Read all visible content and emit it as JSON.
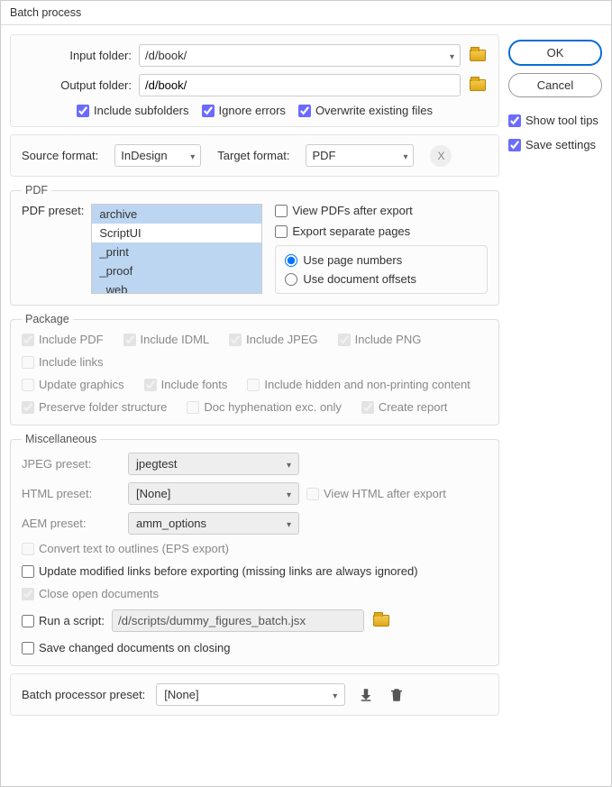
{
  "title": "Batch process",
  "buttons": {
    "ok": "OK",
    "cancel": "Cancel"
  },
  "sidebar": {
    "show_tool_tips": "Show tool tips",
    "save_settings": "Save settings"
  },
  "folders": {
    "input_label": "Input folder:",
    "input_value": "/d/book/",
    "output_label": "Output folder:",
    "output_value": "/d/book/",
    "include_subfolders": "Include subfolders",
    "ignore_errors": "Ignore errors",
    "overwrite": "Overwrite existing files"
  },
  "format": {
    "source_label": "Source format:",
    "source_value": "InDesign",
    "target_label": "Target format:",
    "target_value": "PDF"
  },
  "pdf": {
    "legend": "PDF",
    "preset_label": "PDF preset:",
    "items": [
      "archive",
      "ScriptUI",
      "_print",
      "_proof",
      "_web"
    ],
    "view_after": "View PDFs after export",
    "export_separate": "Export separate pages",
    "use_page_numbers": "Use page numbers",
    "use_doc_offsets": "Use document offsets"
  },
  "package": {
    "legend": "Package",
    "include_pdf": "Include PDF",
    "include_idml": "Include IDML",
    "include_jpeg": "Include JPEG",
    "include_png": "Include PNG",
    "include_links": "Include links",
    "update_graphics": "Update graphics",
    "include_fonts": "Include fonts",
    "include_hidden": "Include hidden and non-printing content",
    "preserve_structure": "Preserve folder structure",
    "doc_hyph": "Doc hyphenation exc. only",
    "create_report": "Create report"
  },
  "misc": {
    "legend": "Miscellaneous",
    "jpeg_label": "JPEG preset:",
    "jpeg_value": "jpegtest",
    "html_label": "HTML preset:",
    "html_value": "[None]",
    "view_html": "View HTML after export",
    "aem_label": "AEM preset:",
    "aem_value": "amm_options",
    "convert_outlines": "Convert text to outlines (EPS export)",
    "update_links": "Update modified links before exporting (missing links are always ignored)",
    "close_docs": "Close open documents",
    "run_script": "Run a script:",
    "script_path": "/d/scripts/dummy_figures_batch.jsx",
    "save_changed": "Save changed documents on closing"
  },
  "batch_preset": {
    "label": "Batch processor preset:",
    "value": "[None]"
  }
}
